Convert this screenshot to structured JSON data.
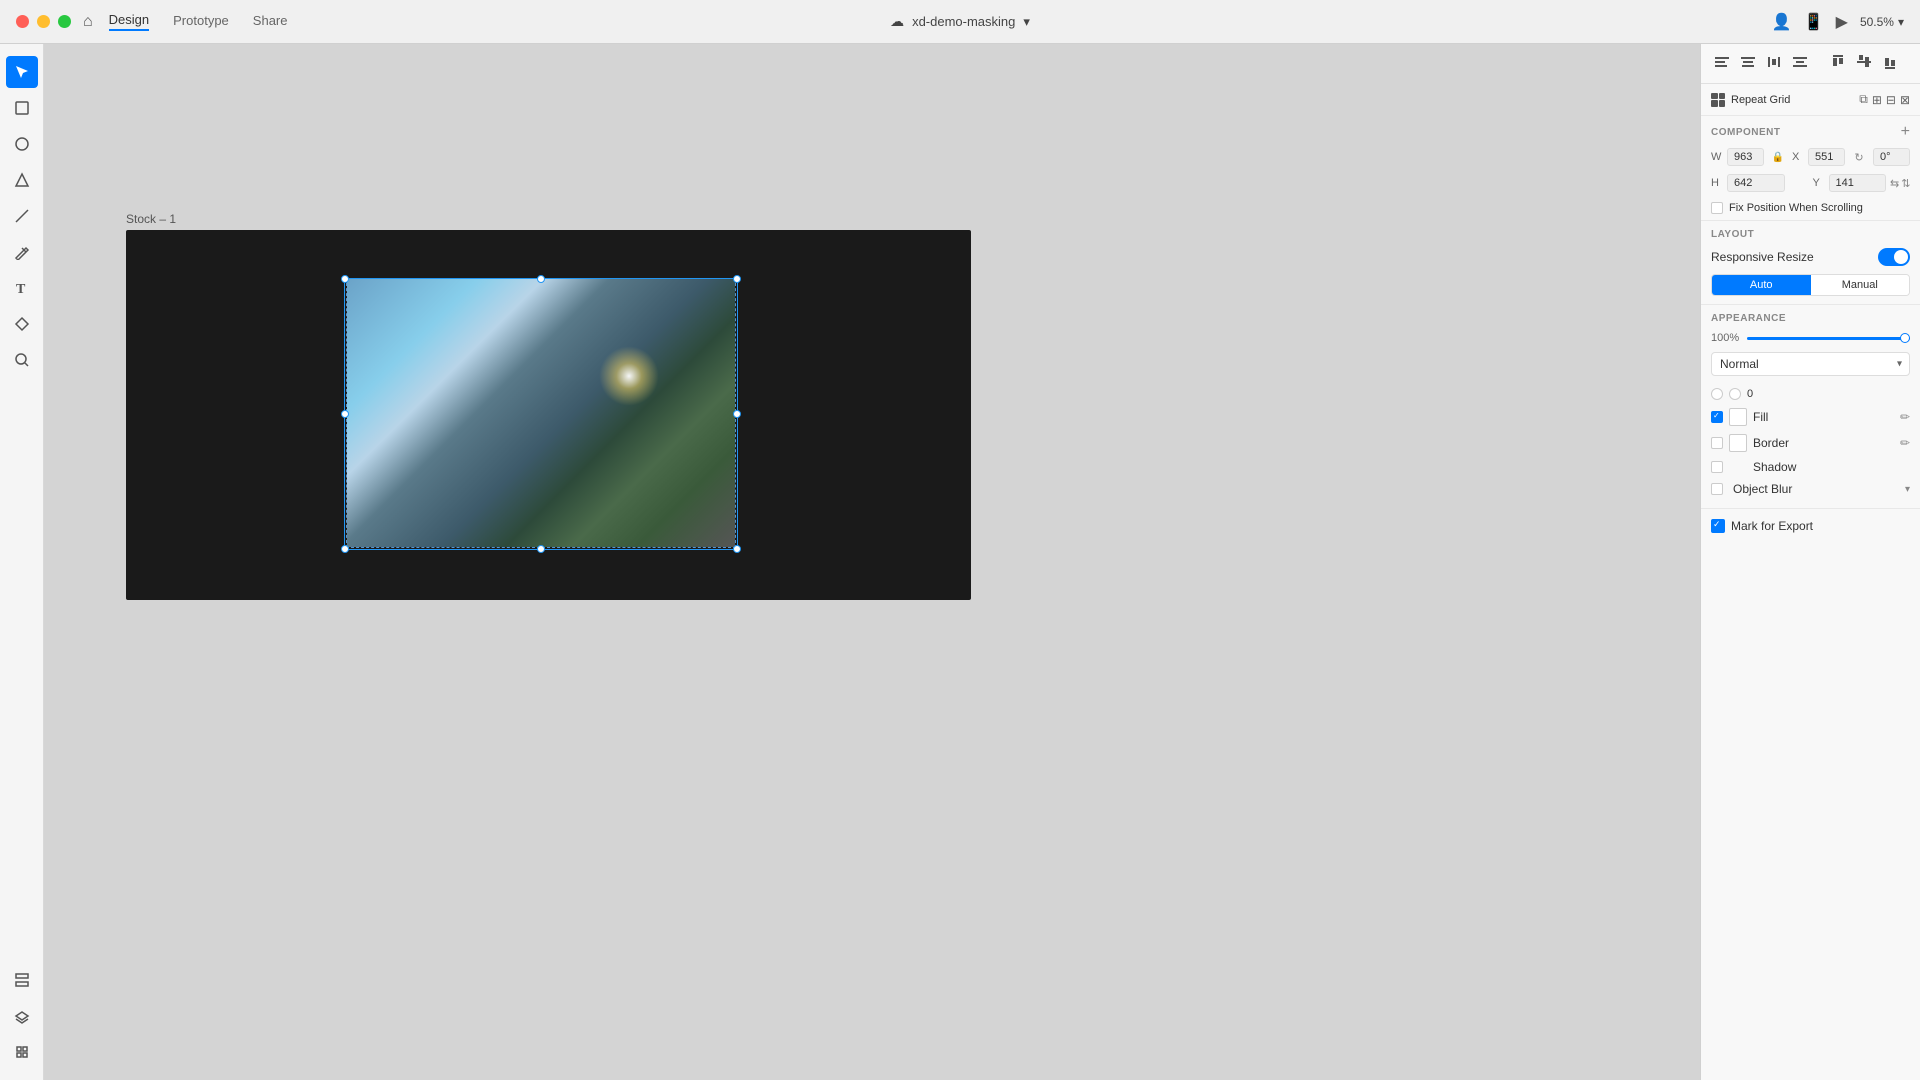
{
  "titlebar": {
    "tabs": [
      "Design",
      "Prototype",
      "Share"
    ],
    "active_tab": "Design",
    "project_name": "xd-demo-masking",
    "zoom": "50.5%"
  },
  "toolbar": {
    "tools": [
      "cursor",
      "rectangle",
      "circle",
      "triangle",
      "line",
      "pen",
      "text",
      "component",
      "search"
    ]
  },
  "artboard": {
    "label": "Stock – 1"
  },
  "right_panel": {
    "repeat_grid_label": "Repeat Grid",
    "component_label": "COMPONENT",
    "add_label": "+",
    "width_label": "W",
    "width_value": "963",
    "height_label": "H",
    "height_value": "642",
    "x_label": "X",
    "x_value": "551",
    "y_label": "Y",
    "y_value": "141",
    "rotation_label": "0°",
    "fix_position_label": "Fix Position When Scrolling",
    "layout_label": "LAYOUT",
    "responsive_resize_label": "Responsive Resize",
    "auto_label": "Auto",
    "manual_label": "Manual",
    "appearance_label": "APPEARANCE",
    "opacity_value": "100%",
    "blend_mode_label": "Normal",
    "shadow_count": "0",
    "fill_label": "Fill",
    "border_label": "Border",
    "shadow_label": "Shadow",
    "object_blur_label": "Object Blur",
    "mark_for_export_label": "Mark for Export"
  }
}
